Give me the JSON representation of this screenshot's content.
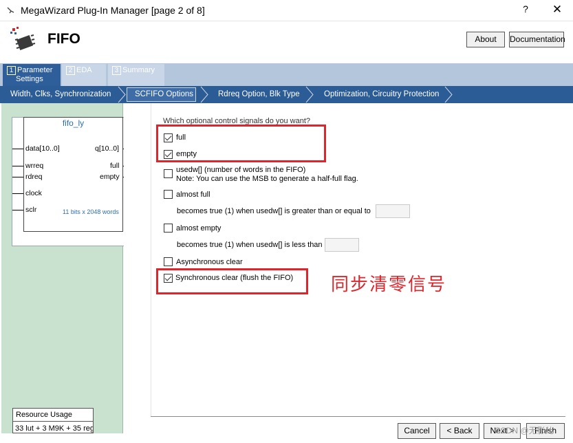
{
  "window": {
    "title": "MegaWizard Plug-In Manager [page 2 of 8]",
    "help_glyph": "?",
    "close_glyph": "✕"
  },
  "header": {
    "title": "FIFO",
    "about_label": "About",
    "documentation_label": "Documentation"
  },
  "tabs": [
    {
      "num": "1",
      "label_line1": "Parameter",
      "label_line2": "Settings"
    },
    {
      "num": "2",
      "label": "EDA"
    },
    {
      "num": "3",
      "label": "Summary"
    }
  ],
  "breadcrumb": [
    "Width, Clks, Synchronization",
    "SCFIFO Options",
    "Rdreq Option, Blk Type",
    "Optimization, Circuitry Protection"
  ],
  "symbol": {
    "title": "fifo_ly",
    "pins_left": [
      "data[10..0]",
      "wrreq",
      "rdreq",
      "clock",
      "sclr"
    ],
    "pins_right": [
      "q[10..0]",
      "full",
      "empty"
    ],
    "note": "11 bits x 2048 words"
  },
  "resource": {
    "heading": "Resource Usage",
    "value": "33 lut + 3 M9K + 35 reg"
  },
  "options": {
    "question": "Which optional control signals do you want?",
    "full": {
      "label": "full",
      "checked": true
    },
    "empty": {
      "label": "empty",
      "checked": true
    },
    "usedw": {
      "label": "usedw[]  (number of words in the FIFO)",
      "note": "Note: You can use the MSB to generate a half-full flag.",
      "checked": false
    },
    "almost_full": {
      "label": "almost full",
      "checked": false,
      "sub": "becomes true (1) when usedw[] is greater than or equal to",
      "value": ""
    },
    "almost_empty": {
      "label": "almost empty",
      "checked": false,
      "sub": "becomes true (1) when usedw[] is less than",
      "value": ""
    },
    "async_clear": {
      "label": "Asynchronous clear",
      "checked": false
    },
    "sync_clear": {
      "label": "Synchronous clear (flush the FIFO)",
      "checked": true
    }
  },
  "annotation": "同步清零信号",
  "footer": {
    "cancel": "Cancel",
    "back": "< Back",
    "next": "Next >",
    "finish": "Finish"
  },
  "watermark": "CSDN @无影儿",
  "colors": {
    "accent": "#2c5c95",
    "annotation_red": "#e0242a",
    "left_panel": "#c9e2d0"
  }
}
